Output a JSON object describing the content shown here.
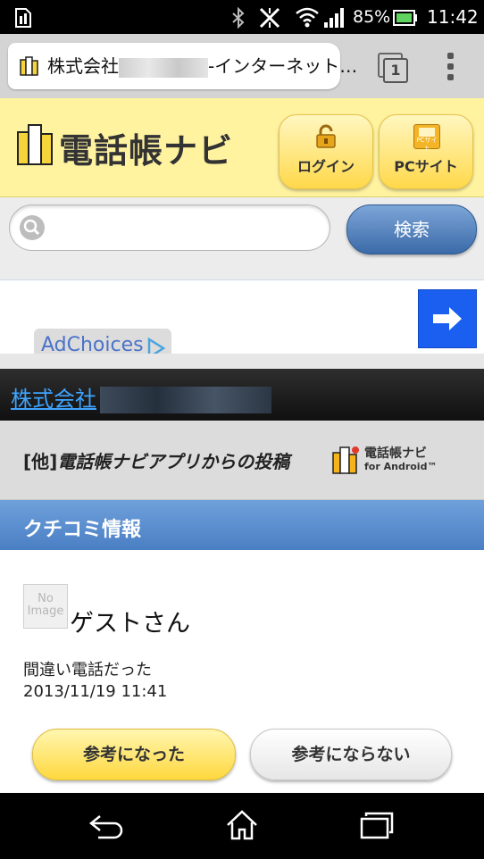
{
  "status_bar": {
    "battery_percent": "85%",
    "time": "11:42"
  },
  "browser": {
    "url_text_prefix": "株式会社",
    "url_text_suffix": "-インターネット…",
    "tab_count": "1"
  },
  "site": {
    "logo_text": "電話帳ナビ",
    "login_label": "ログイン",
    "pc_site_label": "PCサイト",
    "pc_icon_text": "PCサイト"
  },
  "search": {
    "placeholder": "",
    "button_label": "検索"
  },
  "ad": {
    "adchoices_label": "AdChoices"
  },
  "company": {
    "name_prefix": "株式会社"
  },
  "post_source": {
    "tag": "[他]",
    "text": "電話帳ナビアプリからの投稿",
    "logo_title": "電話帳ナビ",
    "logo_sub": "for Android™"
  },
  "reviews": {
    "section_title": "クチコミ情報",
    "noimage_line1": "No",
    "noimage_line2": "Image",
    "author": "ゲストさん",
    "text": "間違い電話だった",
    "timestamp": "2013/11/19 11:41",
    "helpful_label": "参考になった",
    "not_helpful_label": "参考にならない"
  }
}
